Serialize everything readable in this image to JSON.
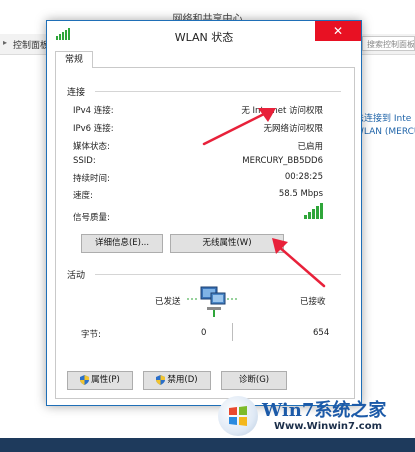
{
  "background_window": {
    "title": "网络和共享中心",
    "breadcrumb": "控制面板",
    "search_placeholder": "搜索控制面板",
    "side_text_1": "法连接到 Inte",
    "side_text_2": "WLAN (MERCU"
  },
  "dialog": {
    "title": "WLAN 状态",
    "close_label": "✕",
    "tab": "常规",
    "connection": {
      "section": "连接",
      "rows": [
        {
          "label": "IPv4 连接:",
          "value": "无 Internet 访问权限"
        },
        {
          "label": "IPv6 连接:",
          "value": "无网络访问权限"
        },
        {
          "label": "媒体状态:",
          "value": "已启用"
        },
        {
          "label": "SSID:",
          "value": "MERCURY_BB5DD6"
        },
        {
          "label": "持续时间:",
          "value": "00:28:25"
        },
        {
          "label": "速度:",
          "value": "58.5 Mbps"
        }
      ],
      "signal_label": "信号质量:",
      "signal_level": 5,
      "signal_max": 5
    },
    "buttons": {
      "details": "详细信息(E)...",
      "wireless_properties": "无线属性(W)",
      "properties": "属性(P)",
      "disable": "禁用(D)",
      "diagnose": "诊断(G)"
    },
    "activity": {
      "section": "活动",
      "sent_label": "已发送",
      "received_label": "已接收",
      "bytes_label": "字节:",
      "bytes_sent": "0",
      "bytes_received": "654"
    }
  },
  "watermark": {
    "brand": "Win7系统之家",
    "url": "Www.Winwin7.com"
  },
  "colors": {
    "accent": "#1f6fb7",
    "close": "#e81123",
    "signal": "#2fa63a",
    "annotation_arrow": "#e8213a"
  }
}
